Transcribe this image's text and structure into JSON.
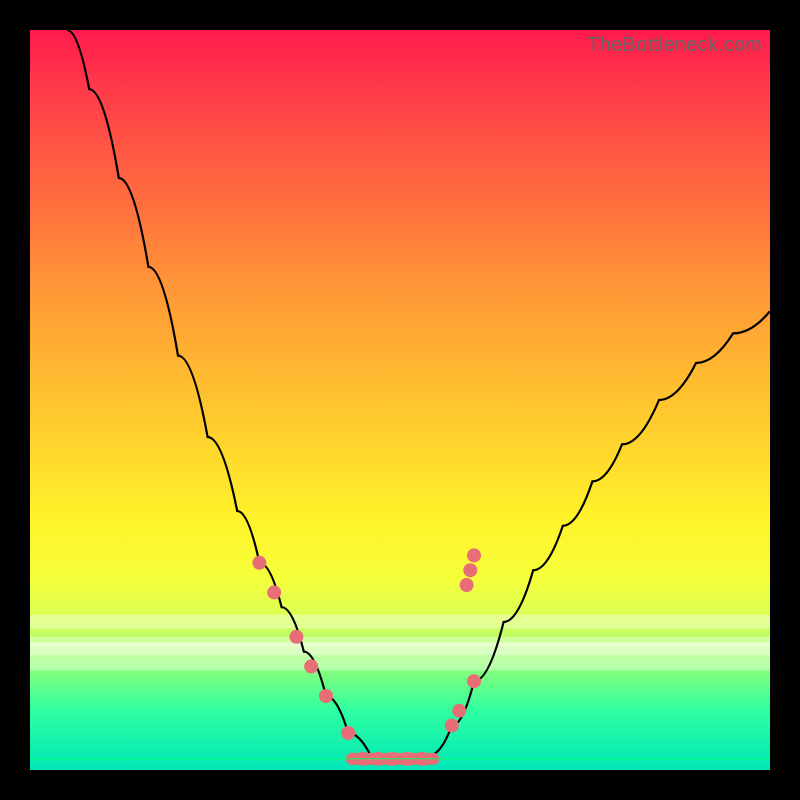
{
  "watermark": "TheBottleneck.com",
  "chart_data": {
    "type": "line",
    "title": "",
    "xlabel": "",
    "ylabel": "",
    "xlim": [
      0,
      100
    ],
    "ylim": [
      0,
      100
    ],
    "curve": [
      {
        "x": 5,
        "y": 100
      },
      {
        "x": 8,
        "y": 92
      },
      {
        "x": 12,
        "y": 80
      },
      {
        "x": 16,
        "y": 68
      },
      {
        "x": 20,
        "y": 56
      },
      {
        "x": 24,
        "y": 45
      },
      {
        "x": 28,
        "y": 35
      },
      {
        "x": 31,
        "y": 28
      },
      {
        "x": 34,
        "y": 22
      },
      {
        "x": 37,
        "y": 16
      },
      {
        "x": 40,
        "y": 10
      },
      {
        "x": 43,
        "y": 5
      },
      {
        "x": 46,
        "y": 2
      },
      {
        "x": 48,
        "y": 1
      },
      {
        "x": 50,
        "y": 1
      },
      {
        "x": 52,
        "y": 1
      },
      {
        "x": 54,
        "y": 2
      },
      {
        "x": 57,
        "y": 6
      },
      {
        "x": 60,
        "y": 12
      },
      {
        "x": 64,
        "y": 20
      },
      {
        "x": 68,
        "y": 27
      },
      {
        "x": 72,
        "y": 33
      },
      {
        "x": 76,
        "y": 39
      },
      {
        "x": 80,
        "y": 44
      },
      {
        "x": 85,
        "y": 50
      },
      {
        "x": 90,
        "y": 55
      },
      {
        "x": 95,
        "y": 59
      },
      {
        "x": 100,
        "y": 62
      }
    ],
    "markers_left": [
      {
        "x": 31,
        "y": 28
      },
      {
        "x": 33,
        "y": 24
      },
      {
        "x": 36,
        "y": 18
      },
      {
        "x": 38,
        "y": 14
      },
      {
        "x": 40,
        "y": 10
      },
      {
        "x": 43,
        "y": 5
      }
    ],
    "markers_right": [
      {
        "x": 57,
        "y": 6
      },
      {
        "x": 58,
        "y": 8
      },
      {
        "x": 60,
        "y": 12
      },
      {
        "x": 59,
        "y": 25
      },
      {
        "x": 59.5,
        "y": 27
      },
      {
        "x": 60,
        "y": 29
      }
    ],
    "plateau": [
      {
        "x": 45,
        "y": 1.5
      },
      {
        "x": 47,
        "y": 1.5
      },
      {
        "x": 49,
        "y": 1.5
      },
      {
        "x": 51,
        "y": 1.5
      },
      {
        "x": 53,
        "y": 1.5
      }
    ],
    "pale_bands_y": [
      18,
      21,
      17.3,
      17,
      16.5,
      16,
      15.5,
      15,
      14.5,
      14
    ],
    "green_line_y": 1.5
  },
  "colors": {
    "curve": "#000000",
    "marker": "#e76d77",
    "band": "rgba(255,255,255,0.35)"
  }
}
